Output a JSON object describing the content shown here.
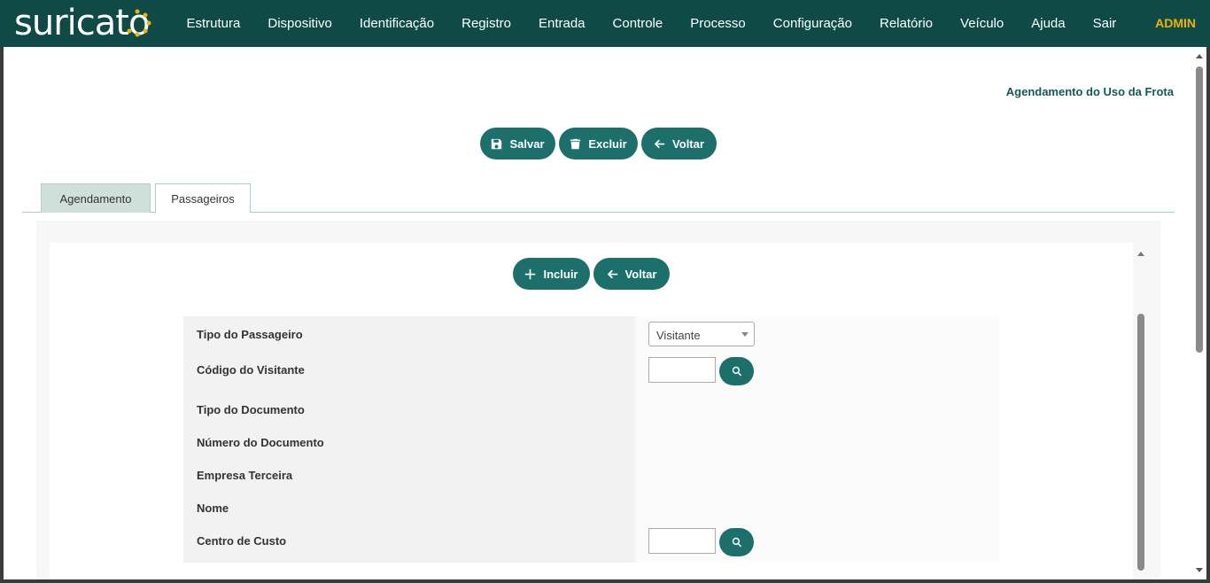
{
  "app": {
    "logo_text": "suricato",
    "brand_color": "#0f4a47",
    "accent_color": "#1d6f6b",
    "user_color": "#f0b400"
  },
  "nav": {
    "items": [
      {
        "label": "Estrutura"
      },
      {
        "label": "Dispositivo"
      },
      {
        "label": "Identificação"
      },
      {
        "label": "Registro"
      },
      {
        "label": "Entrada"
      },
      {
        "label": "Controle"
      },
      {
        "label": "Processo"
      },
      {
        "label": "Configuração"
      },
      {
        "label": "Relatório"
      },
      {
        "label": "Veículo"
      },
      {
        "label": "Ajuda"
      },
      {
        "label": "Sair"
      }
    ],
    "user": "ADMIN"
  },
  "page": {
    "title": "Agendamento do Uso da Frota"
  },
  "toolbar": {
    "save_label": "Salvar",
    "save_icon": "save-icon",
    "delete_label": "Excluir",
    "delete_icon": "trash-icon",
    "back_label": "Voltar",
    "back_icon": "arrow-left-icon"
  },
  "tabs": [
    {
      "label": "Agendamento",
      "active": false
    },
    {
      "label": "Passageiros",
      "active": true
    }
  ],
  "passengers": {
    "add_label": "Incluir",
    "add_icon": "plus-icon",
    "back_label": "Voltar",
    "back_icon": "arrow-left-icon"
  },
  "form": {
    "passenger_type_label": "Tipo do Passageiro",
    "passenger_type_value": "Visitante",
    "visitor_code_label": "Código do Visitante",
    "visitor_code_value": "",
    "document_type_label": "Tipo do Documento",
    "document_number_label": "Número do Documento",
    "third_party_company_label": "Empresa Terceira",
    "name_label": "Nome",
    "cost_center_label": "Centro de Custo",
    "cost_center_value": ""
  }
}
